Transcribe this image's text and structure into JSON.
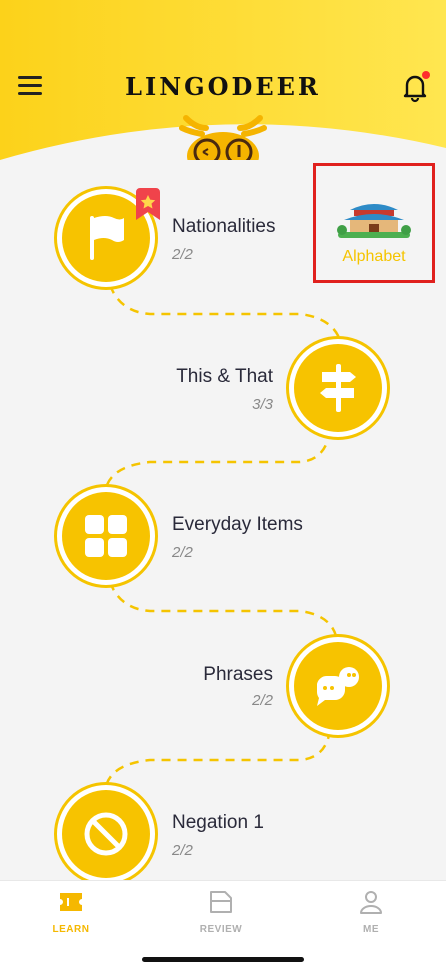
{
  "header": {
    "logo_text": "LINGODEER",
    "bell_badge_color": "#ff2d2d"
  },
  "units": [
    {
      "title": "Nationalities",
      "progress": "2/2",
      "icon": "flag-icon"
    },
    {
      "title": "This & That",
      "progress": "3/3",
      "icon": "signpost-icon"
    },
    {
      "title": "Everyday Items",
      "progress": "2/2",
      "icon": "grid-icon"
    },
    {
      "title": "Phrases",
      "progress": "2/2",
      "icon": "chat-bubbles-icon"
    },
    {
      "title": "Negation 1",
      "progress": "2/2",
      "icon": "prohibited-icon"
    }
  ],
  "alphabet": {
    "label": "Alphabet"
  },
  "tabs": [
    {
      "label": "LEARN",
      "icon": "ticket-icon",
      "active": true
    },
    {
      "label": "REVIEW",
      "icon": "folder-icon",
      "active": false
    },
    {
      "label": "ME",
      "icon": "person-icon",
      "active": false
    }
  ],
  "colors": {
    "accent": "#f7c300",
    "active_tab": "#f5b800",
    "inactive_tab": "#b0b0b0"
  }
}
